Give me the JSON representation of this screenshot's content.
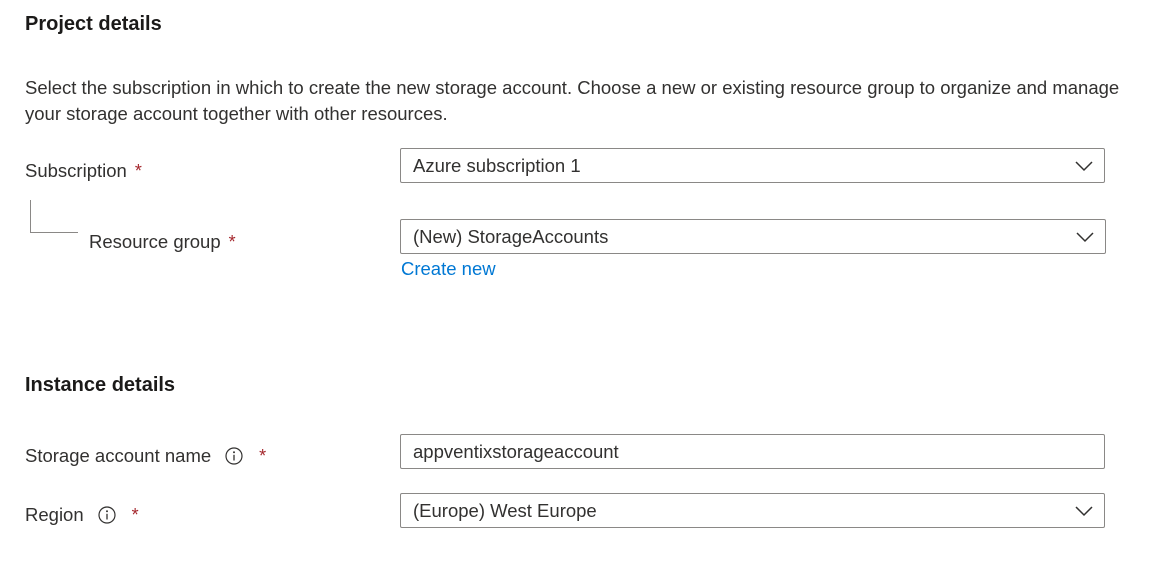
{
  "project": {
    "title": "Project details",
    "description": "Select the subscription in which to create the new storage account. Choose a new or existing resource group to organize and manage your storage account together with other resources."
  },
  "subscription": {
    "label": "Subscription",
    "required_mark": "*",
    "value": "Azure subscription 1",
    "icon": "chevron-down-icon"
  },
  "resource_group": {
    "label": "Resource group",
    "required_mark": "*",
    "value": "(New) StorageAccounts",
    "icon": "chevron-down-icon",
    "create_new": "Create new"
  },
  "instance": {
    "title": "Instance details"
  },
  "storage_account_name": {
    "label": "Storage account name",
    "required_mark": "*",
    "value": "appventixstorageaccount",
    "icon": "info-icon"
  },
  "region": {
    "label": "Region",
    "required_mark": "*",
    "value": "(Europe) West Europe",
    "icons": [
      "info-icon",
      "chevron-down-icon"
    ]
  },
  "colors": {
    "link": "#0078d4",
    "required": "#a4262c",
    "border": "#8a8886",
    "text": "#323130"
  }
}
